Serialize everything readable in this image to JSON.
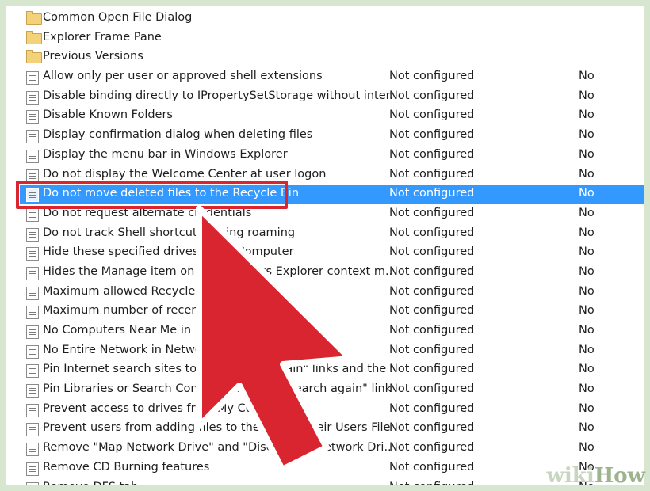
{
  "folders": [
    {
      "name": "Common Open File Dialog"
    },
    {
      "name": "Explorer Frame Pane"
    },
    {
      "name": "Previous Versions"
    }
  ],
  "policies": [
    {
      "name": "Allow only per user or approved shell extensions",
      "state": "Not configured",
      "comment": "No"
    },
    {
      "name": "Disable binding directly to IPropertySetStorage without inter...",
      "state": "Not configured",
      "comment": "No"
    },
    {
      "name": "Disable Known Folders",
      "state": "Not configured",
      "comment": "No"
    },
    {
      "name": "Display confirmation dialog when deleting files",
      "state": "Not configured",
      "comment": "No"
    },
    {
      "name": "Display the menu bar in Windows Explorer",
      "state": "Not configured",
      "comment": "No"
    },
    {
      "name": "Do not display the Welcome Center at user logon",
      "state": "Not configured",
      "comment": "No"
    },
    {
      "name": "Do not move deleted files to the Recycle Bin",
      "state": "Not configured",
      "comment": "No",
      "selected": true
    },
    {
      "name": "Do not request alternate credentials",
      "state": "Not configured",
      "comment": "No"
    },
    {
      "name": "Do not track Shell shortcuts during roaming",
      "state": "Not configured",
      "comment": "No"
    },
    {
      "name": "Hide these specified drives in My Computer",
      "state": "Not configured",
      "comment": "No"
    },
    {
      "name": "Hides the Manage item on the Windows Explorer context m...",
      "state": "Not configured",
      "comment": "No"
    },
    {
      "name": "Maximum allowed Recycle Bin size",
      "state": "Not configured",
      "comment": "No"
    },
    {
      "name": "Maximum number of recent documents",
      "state": "Not configured",
      "comment": "No"
    },
    {
      "name": "No Computers Near Me in Network Locations",
      "state": "Not configured",
      "comment": "No"
    },
    {
      "name": "No Entire Network in Network Locations",
      "state": "Not configured",
      "comment": "No"
    },
    {
      "name": "Pin Internet search sites to the \"Search again\" links and the S...",
      "state": "Not configured",
      "comment": "No"
    },
    {
      "name": "Pin Libraries or Search Connectors to the \"Search again\" link...",
      "state": "Not configured",
      "comment": "No"
    },
    {
      "name": "Prevent access to drives from My Computer",
      "state": "Not configured",
      "comment": "No"
    },
    {
      "name": "Prevent users from adding files to the root of their Users File...",
      "state": "Not configured",
      "comment": "No"
    },
    {
      "name": "Remove \"Map Network Drive\" and \"Disconnect Network Dri...",
      "state": "Not configured",
      "comment": "No"
    },
    {
      "name": "Remove CD Burning features",
      "state": "Not configured",
      "comment": "No"
    },
    {
      "name": "Remove DFS tab",
      "state": "Not configured",
      "comment": "No"
    }
  ],
  "watermark": {
    "prefix": "wiki",
    "suffix": "How"
  },
  "colors": {
    "selection": "#3399ff",
    "highlight_box": "#d8252f",
    "arrow": "#d8252f"
  },
  "icons": {
    "folder": "folder-icon",
    "setting": "policy-setting-icon",
    "arrow": "pointer-arrow"
  }
}
